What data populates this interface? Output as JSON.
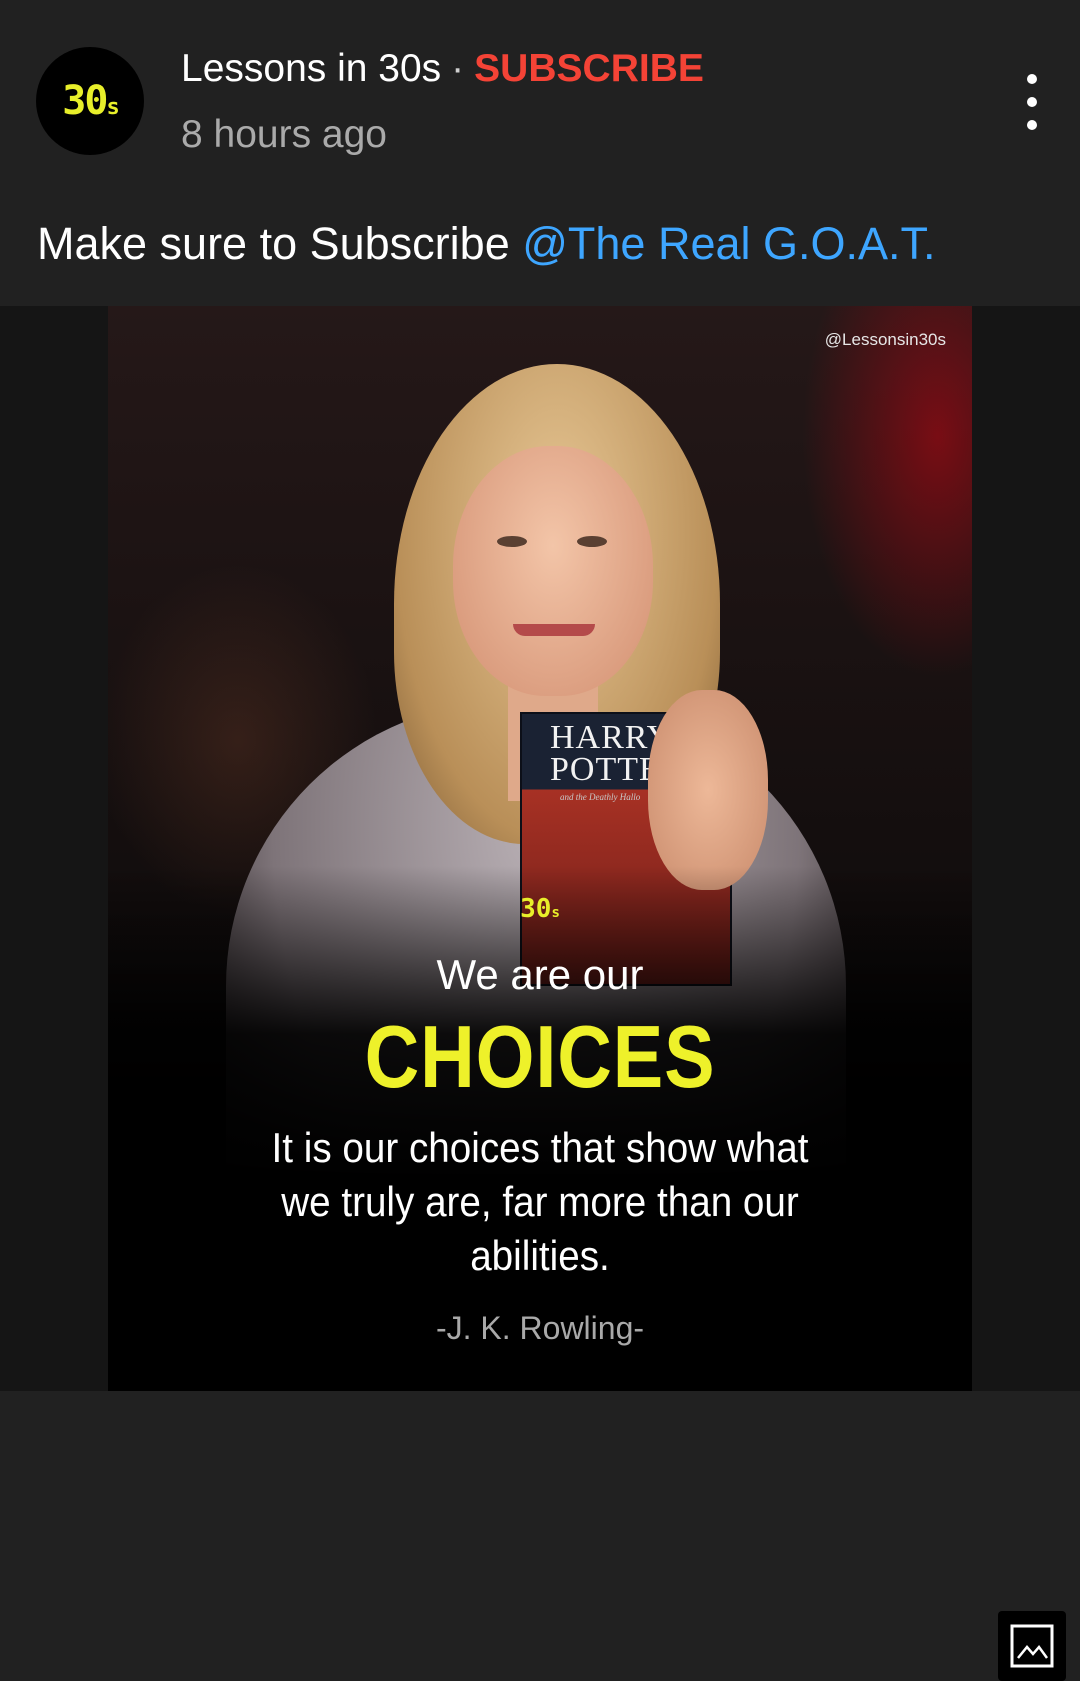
{
  "post": {
    "avatar_text": "30",
    "avatar_suffix": "s",
    "channel_name": "Lessons in 30s",
    "separator": "·",
    "subscribe_label": "SUBSCRIBE",
    "timestamp": "8 hours ago",
    "text_prefix": "Make sure to Subscribe ",
    "mention": "@The Real G.O.A.T."
  },
  "image": {
    "watermark": "@Lessonsin30s",
    "book_title_line1": "HARRY",
    "book_title_line2": "POTTE",
    "book_subtitle": "and the Deathly Hallo",
    "logo_text": "30",
    "logo_suffix": "s",
    "quote_line1": "We are our",
    "quote_line2": "CHOICES",
    "quote_body": "It is our choices that show what we truly are, far more than our abilities.",
    "quote_author": "-J. K. Rowling-"
  },
  "icons": {
    "menu": "more-vert-icon",
    "gallery": "image-gallery-icon"
  },
  "colors": {
    "background": "#212121",
    "subscribe": "#f44336",
    "mention": "#3ea6ff",
    "accent_yellow": "#eef12a",
    "muted": "#aaaaaa"
  }
}
